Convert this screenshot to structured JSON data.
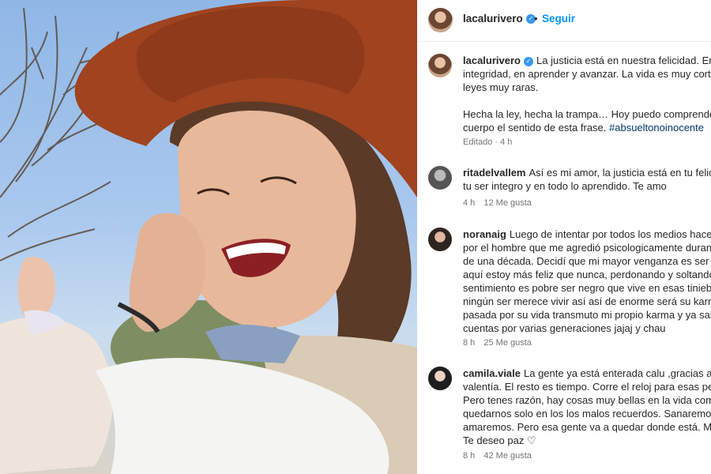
{
  "post": {
    "username": "lacalurivero",
    "verified_icon": "verified-badge-icon",
    "follow_label": "Seguir",
    "dot": "•"
  },
  "caption": {
    "username": "lacalurivero",
    "line1": "La justicia está en nuestra felicidad. En mi",
    "line2": "integridad, en aprender y avanzar. La vida es muy corta",
    "line3": "leyes muy raras.",
    "line4": "Hecha la ley, hecha la trampa… Hoy puedo comprender",
    "line5a": "cuerpo el sentido de esta frase. ",
    "hashtag": "#absueltonoinocente",
    "edited": "Editado · 4 h"
  },
  "comments": [
    {
      "username": "ritadelvallem",
      "lines": [
        "Así es mi amor, la justicia está en tu felicidad",
        "tu ser integro y en todo lo aprendido. Te amo"
      ],
      "time": "4 h",
      "likes": "12 Me gusta"
    },
    {
      "username": "noranaig",
      "lines": [
        "Luego de intentar por todos los medios hacer justicia",
        "por el hombre que me agredió psicologicamente durante",
        "de una década. Decidí que mi mayor venganza es ser Feliz",
        "aquí estoy más feliz que nunca, perdonando y soltando",
        "sentimiento es pobre ser negro que vive en esas tinieblas",
        "ningún ser merece vivir así así de enorme será su karma",
        "pasada por su vida transmuto mi propio karma y ya saldrá",
        "cuentas por varias generaciones jajaj y chau"
      ],
      "time": "8 h",
      "likes": "25 Me gusta"
    },
    {
      "username": "camila.viale",
      "lines": [
        "La gente ya está enterada calu ,gracias a tu",
        "valentía. El resto es tiempo. Corre el reloj para esas personas",
        "Pero tenes razón, hay cosas muy bellas en la vida como",
        "quedarnos solo en los los malos recuerdos. Sanaremos y",
        "amaremos. Pero esa gente va a quedar donde está. Mereces",
        "Te deseo paz ♡"
      ],
      "time": "8 h",
      "likes": "42 Me gusta"
    }
  ],
  "colors": {
    "link": "#0095f6",
    "hashtag": "#00376b",
    "meta": "#737373"
  }
}
